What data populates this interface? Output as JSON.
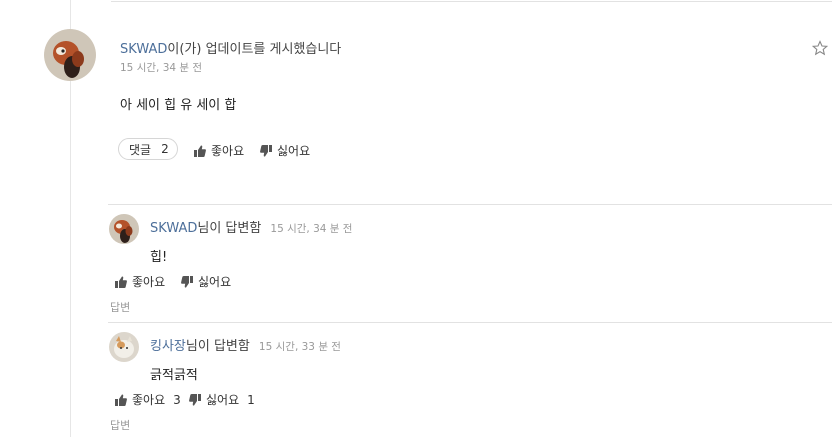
{
  "post": {
    "author": "SKWAD",
    "action_text": "이(가) 업데이트를 게시했습니다",
    "time": "15 시간, 34 분 전",
    "body": "아 세이 힙 유 세이 합",
    "comment_label": "댓글",
    "comment_count": "2",
    "like_label": "좋아요",
    "dislike_label": "싫어요"
  },
  "replies": [
    {
      "author": "SKWAD",
      "action_text": "님이 답변함",
      "time": "15 시간, 34 분 전",
      "body": "힙!",
      "like_label": "좋아요",
      "like_count": "",
      "dislike_label": "싫어요",
      "dislike_count": "",
      "reply_label": "답변"
    },
    {
      "author": "킹사장",
      "action_text": "님이 답변함",
      "time": "15 시간, 33 분 전",
      "body": "긁적긁적",
      "like_label": "좋아요",
      "like_count": "3",
      "dislike_label": "싫어요",
      "dislike_count": "1",
      "reply_label": "답변"
    }
  ],
  "icons": {
    "like": "thumbs-up-icon",
    "dislike": "thumbs-down-icon",
    "favorite": "star-outline-icon"
  }
}
